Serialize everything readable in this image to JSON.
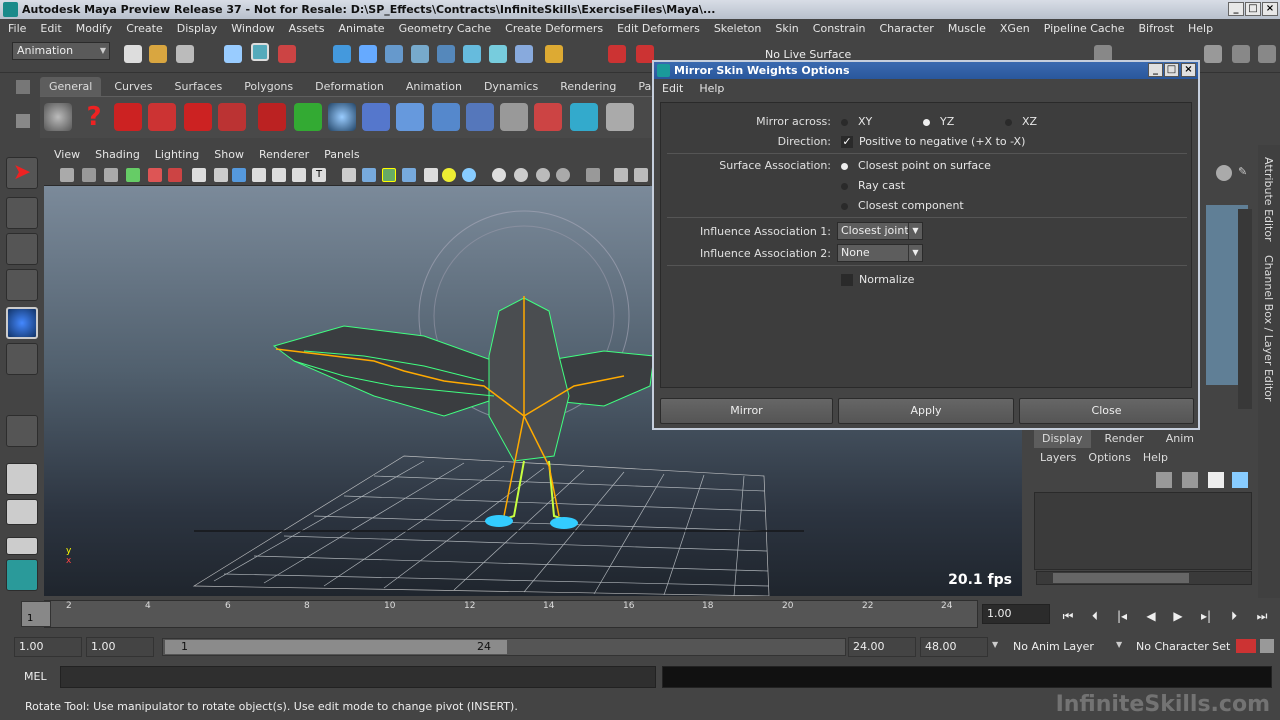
{
  "window": {
    "title": "Autodesk Maya Preview Release 37 - Not for Resale: D:\\SP_Effects\\Contracts\\InfiniteSkills\\ExerciseFiles\\Maya\\..."
  },
  "menubar": [
    "File",
    "Edit",
    "Modify",
    "Create",
    "Display",
    "Window",
    "Assets",
    "Animate",
    "Geometry Cache",
    "Create Deformers",
    "Edit Deformers",
    "Skeleton",
    "Skin",
    "Constrain",
    "Character",
    "Muscle",
    "XGen",
    "Pipeline Cache",
    "Bifrost",
    "Help"
  ],
  "statusline": {
    "menu_set": "Animation",
    "live_surface": "No Live Surface"
  },
  "shelf": {
    "tabs": [
      "General",
      "Curves",
      "Surfaces",
      "Polygons",
      "Deformation",
      "Animation",
      "Dynamics",
      "Rendering",
      "PaintEffects"
    ],
    "active_tab": "General"
  },
  "viewport": {
    "menu": [
      "View",
      "Shading",
      "Lighting",
      "Show",
      "Renderer",
      "Panels"
    ],
    "fps": "20.1 fps",
    "axis_y": "y",
    "axis_x": "x"
  },
  "dialog": {
    "title": "Mirror Skin Weights Options",
    "menu": [
      "Edit",
      "Help"
    ],
    "mirror_across_label": "Mirror across:",
    "mirror_options": [
      "XY",
      "YZ",
      "XZ"
    ],
    "mirror_selected": "YZ",
    "direction_label": "Direction:",
    "direction_check": "Positive to negative (+X to -X)",
    "direction_checked": true,
    "surface_label": "Surface Association:",
    "surface_options": [
      "Closest point on surface",
      "Ray cast",
      "Closest component"
    ],
    "surface_selected": "Closest point on surface",
    "influence1_label": "Influence Association 1:",
    "influence1_value": "Closest joint",
    "influence2_label": "Influence Association 2:",
    "influence2_value": "None",
    "normalize_label": "Normalize",
    "normalize_checked": false,
    "buttons": {
      "mirror": "Mirror",
      "apply": "Apply",
      "close": "Close"
    }
  },
  "right_panel": {
    "tabs": [
      "Display",
      "Render",
      "Anim"
    ],
    "active_tab": "Display",
    "layer_menu": [
      "Layers",
      "Options",
      "Help"
    ],
    "side_tabs": [
      "Attribute Editor",
      "Channel Box / Layer Editor"
    ]
  },
  "timeline": {
    "ticks": [
      "2",
      "4",
      "6",
      "8",
      "10",
      "12",
      "14",
      "16",
      "18",
      "20",
      "22",
      "24"
    ],
    "current_frame": "1",
    "current_time_field": "1.00"
  },
  "range": {
    "start": "1.00",
    "playback_start": "1.00",
    "slider_start": "1",
    "slider_end": "24",
    "playback_end": "24.00",
    "end": "48.00",
    "anim_layer": "No Anim Layer",
    "character_set": "No Character Set"
  },
  "cmdline": {
    "label": "MEL"
  },
  "helpline": {
    "text": "Rotate Tool: Use manipulator to rotate object(s). Use edit mode to change pivot (INSERT)."
  },
  "watermark": "InfiniteSkills.com",
  "colors": {
    "dialog_title": "#2a579c",
    "viewport_top": "#7b8a9a",
    "wireframe": "#40ff80"
  }
}
